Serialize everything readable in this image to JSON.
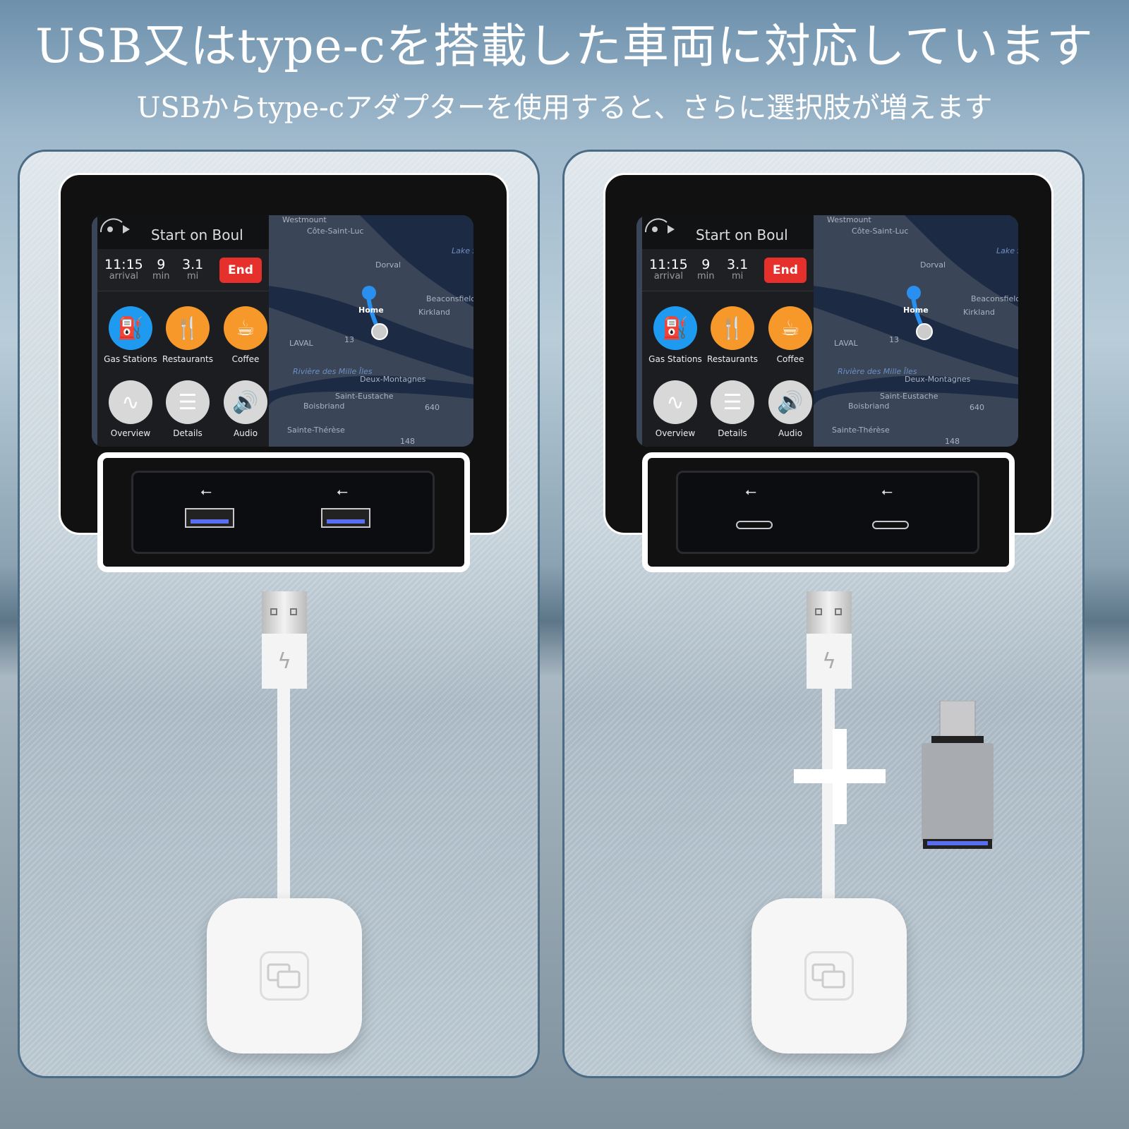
{
  "headline": "USB又はtype-cを搭載した車両に対応しています",
  "subheadline": "USBからtype-cアダプターを使用すると、さらに選択肢が増えます",
  "carplay": {
    "instruction": "Start on Boul",
    "arrival": "11:15",
    "arrival_label": "arrival",
    "minutes": "9",
    "minutes_label": "min",
    "distance": "3.1",
    "distance_label": "mi",
    "end_label": "End",
    "buttons": [
      {
        "label": "Gas Stations",
        "icon": "gas-pump-icon",
        "color": "#1e9bf0",
        "glyph": "⛽"
      },
      {
        "label": "Restaurants",
        "icon": "fork-knife-icon",
        "color": "#f7982a",
        "glyph": "🍴"
      },
      {
        "label": "Coffee",
        "icon": "coffee-cup-icon",
        "color": "#f7982a",
        "glyph": "☕"
      },
      {
        "label": "Overview",
        "icon": "route-icon",
        "color": "#d8d8d8",
        "glyph": "∿"
      },
      {
        "label": "Details",
        "icon": "list-icon",
        "color": "#d8d8d8",
        "glyph": "☰"
      },
      {
        "label": "Audio",
        "icon": "speaker-icon",
        "color": "#d8d8d8",
        "glyph": "🔊"
      }
    ],
    "map_labels": [
      "Westmount",
      "Côte-Saint-Luc",
      "Dorval",
      "Lake Saint-Louis",
      "Beaconsfield",
      "Kirkland",
      "Home",
      "LAVAL",
      "Deux-Montagnes",
      "Saint-Eustache",
      "Boisbriand",
      "Sainte-Thérèse",
      "Rivière des Mille Îles",
      "13",
      "640",
      "148"
    ]
  },
  "panels": [
    {
      "port_type": "usb-a"
    },
    {
      "port_type": "usb-c"
    }
  ],
  "usb_symbol": "⭠"
}
